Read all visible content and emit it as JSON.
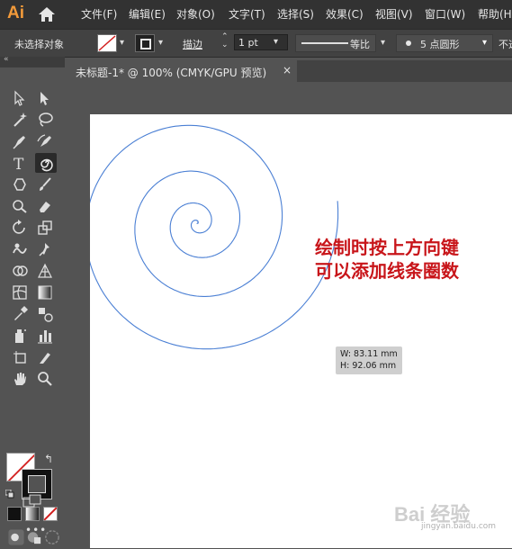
{
  "app": {
    "logo": "Ai",
    "colors": {
      "logo": "#f29a3a",
      "annotation": "#c8151a",
      "spiral": "#4a7fd4"
    }
  },
  "menu": {
    "items": [
      "文件(F)",
      "编辑(E)",
      "对象(O)",
      "文字(T)",
      "选择(S)",
      "效果(C)",
      "视图(V)",
      "窗口(W)",
      "帮助(H)"
    ]
  },
  "control_bar": {
    "selection": "未选择对象",
    "stroke_label": "描边",
    "stroke_weight": "1 pt",
    "profile": "等比",
    "brush": "5 点圆形",
    "opacity_label": "不透"
  },
  "document": {
    "tab_title": "未标题-1* @ 100% (CMYK/GPU 预览)",
    "close": "×"
  },
  "tools": [
    "selection-tool",
    "direct-selection-tool",
    "magic-wand-tool",
    "lasso-tool",
    "pen-tool",
    "curvature-tool",
    "type-tool",
    "spiral-tool",
    "ellipse-tool",
    "paintbrush-tool",
    "shaper-tool",
    "eraser-tool",
    "rotate-tool",
    "scale-tool",
    "warp-tool",
    "puppet-warp-tool",
    "shape-builder-tool",
    "perspective-tool",
    "mesh-tool",
    "gradient-tool",
    "eyedropper-tool",
    "blend-tool",
    "symbol-sprayer-tool",
    "column-graph-tool",
    "artboard-tool",
    "slice-tool",
    "hand-tool",
    "zoom-tool"
  ],
  "annotation": {
    "line1": "绘制时按上方向键",
    "line2": "可以添加线条圈数"
  },
  "tooltip": {
    "width": "W: 83.11 mm",
    "height": "H: 92.06 mm"
  },
  "watermark": {
    "main": "Bai 经验",
    "url": "jingyan.baidu.com"
  },
  "more_label": "•••"
}
